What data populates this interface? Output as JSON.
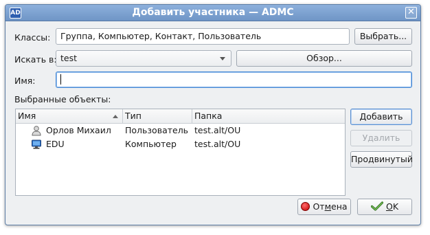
{
  "window": {
    "title": "Добавить участника — ADMC",
    "app_icon_text": "AD",
    "close_glyph": "✕"
  },
  "form": {
    "classes_label": "Классы:",
    "classes_value": "Группа, Компьютер, Контакт, Пользователь",
    "select_button": "Выбрать...",
    "search_in_label": "Искать в:",
    "search_in_value": "test",
    "browse_button": "Обзор...",
    "name_label": "Имя:",
    "name_value": ""
  },
  "selected": {
    "label": "Выбранные объекты:",
    "columns": [
      "Имя",
      "Тип",
      "Папка"
    ],
    "sorted_column": "Имя",
    "rows": [
      {
        "name": "Орлов Михаил",
        "type": "Пользователь",
        "folder": "test.alt/OU",
        "icon": "user-icon"
      },
      {
        "name": "EDU",
        "type": "Компьютер",
        "folder": "test.alt/OU",
        "icon": "computer-icon"
      }
    ]
  },
  "side_buttons": {
    "add": "Добавить",
    "remove": "Удалить",
    "advanced": "Продвинутый"
  },
  "footer": {
    "cancel_pre": "От",
    "cancel_ul": "м",
    "cancel_post": "ена",
    "ok_ul": "O",
    "ok_post": "K"
  },
  "colors": {
    "titlebar": "#7aa0d0",
    "focus": "#4a8bd6",
    "cancel_icon": "#c40000",
    "ok_icon": "#3a8a2a"
  }
}
